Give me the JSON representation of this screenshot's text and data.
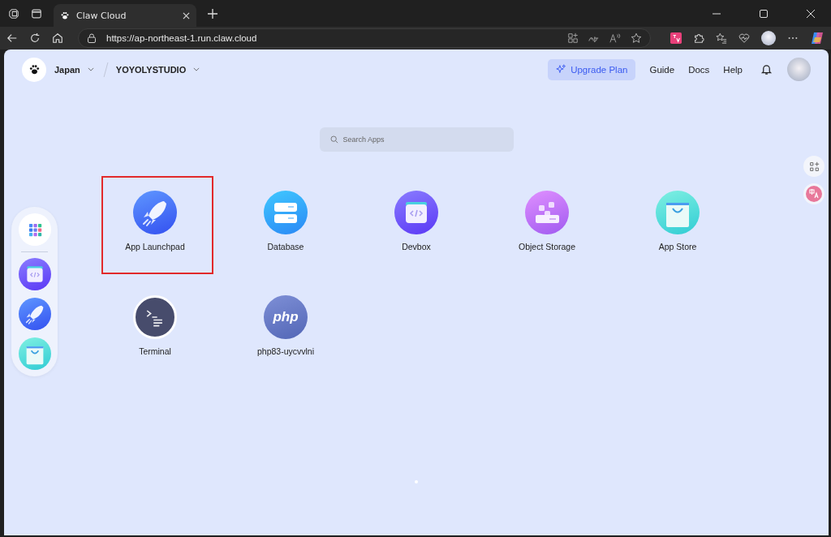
{
  "browser": {
    "tab": {
      "title": "Claw Cloud"
    },
    "url": "https://ap-northeast-1.run.claw.cloud"
  },
  "header": {
    "region": "Japan",
    "workspace": "YOYOLYSTUDIO",
    "upgrade": "Upgrade Plan",
    "links": [
      "Guide",
      "Docs",
      "Help"
    ]
  },
  "search": {
    "placeholder": "Search Apps"
  },
  "apps": [
    {
      "name": "App Launchpad",
      "kind": "rocket",
      "highlighted": true
    },
    {
      "name": "Database",
      "kind": "database",
      "highlighted": false
    },
    {
      "name": "Devbox",
      "kind": "devbox",
      "highlighted": false
    },
    {
      "name": "Object Storage",
      "kind": "storage",
      "highlighted": false
    },
    {
      "name": "App Store",
      "kind": "store",
      "highlighted": false
    },
    {
      "name": "Terminal",
      "kind": "terminal",
      "highlighted": false
    },
    {
      "name": "php83-uycvvlni",
      "kind": "php",
      "icon_text": "php",
      "highlighted": false
    }
  ],
  "dock": [
    {
      "kind": "grid"
    },
    {
      "kind": "devbox"
    },
    {
      "kind": "rocket"
    },
    {
      "kind": "store"
    }
  ],
  "pager": [
    {
      "selected": true
    }
  ]
}
